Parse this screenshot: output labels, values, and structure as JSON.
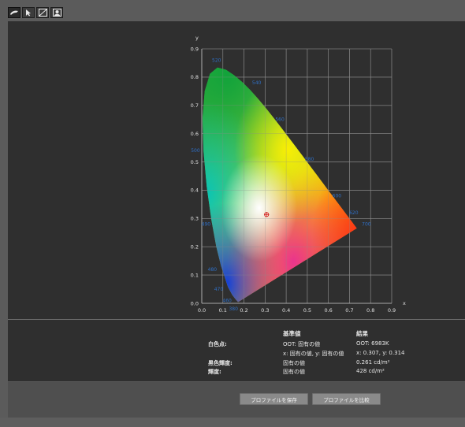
{
  "toolbar": {
    "tools": [
      {
        "icon": "brush-icon"
      },
      {
        "icon": "cursor-icon"
      },
      {
        "icon": "curve-icon"
      },
      {
        "icon": "portrait-icon"
      }
    ]
  },
  "chart_data": {
    "type": "scatter",
    "title": "",
    "xlabel": "x",
    "ylabel": "y",
    "xlim": [
      0.0,
      0.9
    ],
    "ylim": [
      0.0,
      0.9
    ],
    "xticks": [
      "0.0",
      "0.1",
      "0.2",
      "0.3",
      "0.4",
      "0.5",
      "0.6",
      "0.7",
      "0.8",
      "0.9"
    ],
    "yticks": [
      "0.0",
      "0.1",
      "0.2",
      "0.3",
      "0.4",
      "0.5",
      "0.6",
      "0.7",
      "0.8",
      "0.9"
    ],
    "grid": true,
    "wavelength_labels": [
      {
        "label": "520",
        "x": 0.07,
        "y": 0.86
      },
      {
        "label": "540",
        "x": 0.26,
        "y": 0.78
      },
      {
        "label": "560",
        "x": 0.37,
        "y": 0.65
      },
      {
        "label": "580",
        "x": 0.51,
        "y": 0.51
      },
      {
        "label": "600",
        "x": 0.64,
        "y": 0.38
      },
      {
        "label": "620",
        "x": 0.72,
        "y": 0.32
      },
      {
        "label": "700",
        "x": 0.78,
        "y": 0.28
      },
      {
        "label": "500",
        "x": -0.03,
        "y": 0.54
      },
      {
        "label": "490",
        "x": 0.02,
        "y": 0.28
      },
      {
        "label": "480",
        "x": 0.05,
        "y": 0.12
      },
      {
        "label": "470",
        "x": 0.08,
        "y": 0.05
      },
      {
        "label": "460",
        "x": 0.12,
        "y": 0.01
      },
      {
        "label": "380",
        "x": 0.15,
        "y": -0.02
      }
    ],
    "white_point": {
      "x": 0.307,
      "y": 0.314
    }
  },
  "info": {
    "col_ref": "基準値",
    "col_result": "結果",
    "rows": [
      {
        "label": "白色点:",
        "ref": "OOT: 固有の値",
        "result": "OOT: 6983K"
      },
      {
        "label": "",
        "ref": "x: 固有の値, y: 固有の値",
        "result": "x: 0.307, y: 0.314"
      },
      {
        "label": "黒色輝度:",
        "ref": "固有の値",
        "result": "0.261 cd/m²"
      },
      {
        "label": "輝度:",
        "ref": "固有の値",
        "result": "428 cd/m²"
      }
    ]
  },
  "buttons": {
    "save": "プロファイルを保存",
    "compare": "プロファイルを比較"
  },
  "colors": {
    "panel": "#2f2f2f",
    "wavelength_label": "#2f6fc6",
    "white_point_marker": "#d21b1b"
  }
}
